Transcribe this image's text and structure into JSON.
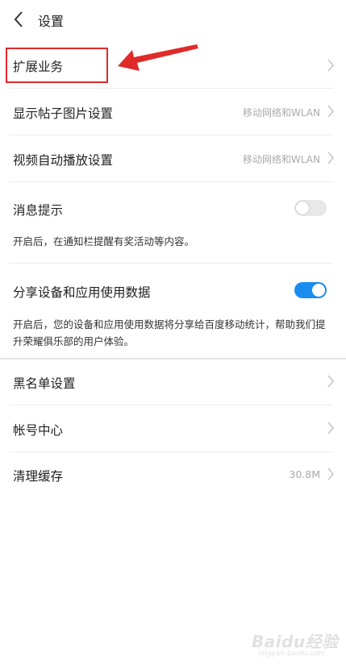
{
  "header": {
    "title": "设置",
    "back_icon": "back-icon"
  },
  "items": {
    "extension": {
      "label": "扩展业务"
    },
    "post_image": {
      "label": "显示帖子图片设置",
      "value": "移动网络和WLAN"
    },
    "video_autoplay": {
      "label": "视频自动播放设置",
      "value": "移动网络和WLAN"
    },
    "notify": {
      "label": "消息提示",
      "state": "off",
      "desc": "开启后，在通知栏提醒有奖活动等内容。"
    },
    "share_data": {
      "label": "分享设备和应用使用数据",
      "state": "on",
      "desc": "开启后，您的设备和应用使用数据将分享给百度移动统计，帮助我们提升荣耀俱乐部的用户体验。"
    },
    "blacklist": {
      "label": "黑名单设置"
    },
    "account": {
      "label": "帐号中心"
    },
    "cache": {
      "label": "清理缓存",
      "value": "30.8M"
    }
  },
  "annotation": {
    "box_color": "#e02a2a",
    "arrow_color": "#e02a2a"
  },
  "colors": {
    "toggle_on": "#1a8cf0",
    "toggle_off": "#e8e8e8"
  },
  "watermark": {
    "text": "Baidu经验",
    "sub": "jingyan.baidu.com"
  }
}
